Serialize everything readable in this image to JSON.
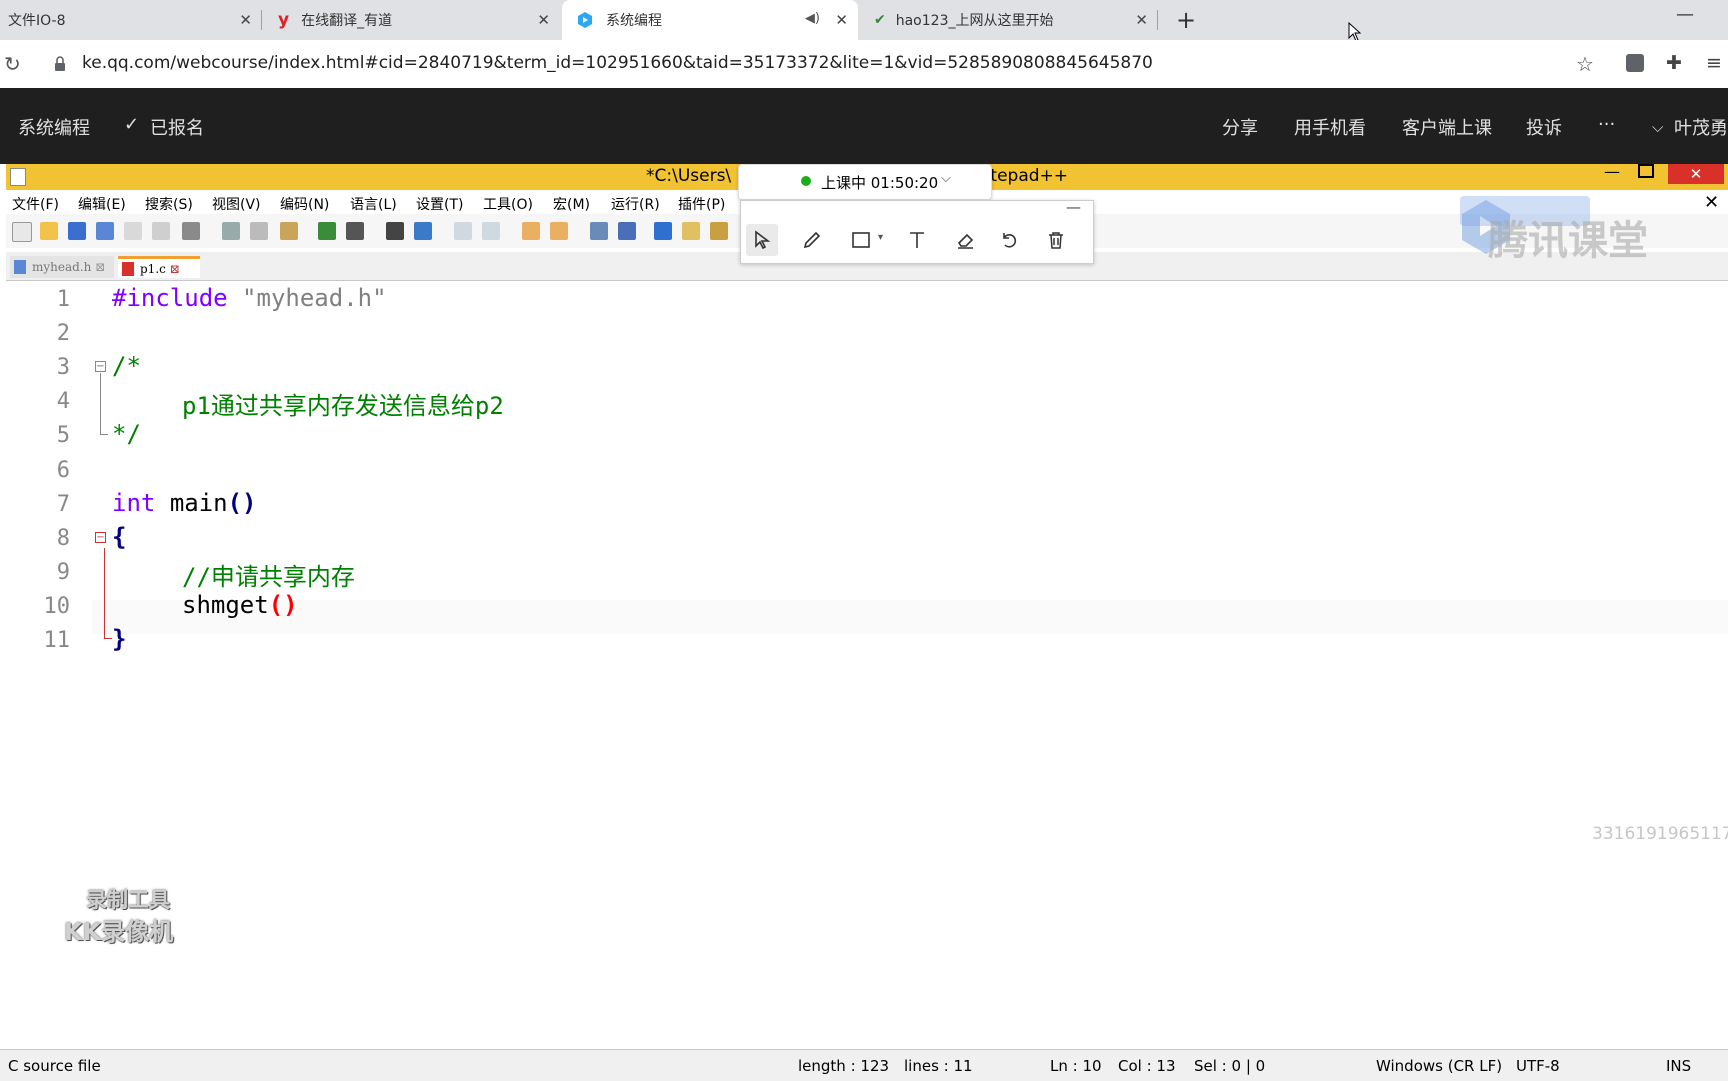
{
  "browser": {
    "tabs": [
      {
        "title": "文件IO-8"
      },
      {
        "title": "在线翻译_有道"
      },
      {
        "title": "系统编程"
      },
      {
        "title": "hao123_上网从这里开始"
      }
    ],
    "url": "ke.qq.com/webcourse/index.html#cid=2840719&term_id=102951660&taid=35173372&lite=1&vid=5285890808845645870"
  },
  "site": {
    "course_title": "系统编程",
    "enrolled": "已报名",
    "nav": [
      "分享",
      "用手机看",
      "客户端上课",
      "投诉",
      "···"
    ],
    "user": "叶茂勇"
  },
  "notepad": {
    "title_left": "*C:\\Users\\",
    "title_right": "otepad++",
    "menu": [
      "文件(F)",
      "编辑(E)",
      "搜索(S)",
      "视图(V)",
      "编码(N)",
      "语言(L)",
      "设置(T)",
      "工具(O)",
      "宏(M)",
      "运行(R)",
      "插件(P)"
    ],
    "doc_tabs": [
      "myhead.h",
      "p1.c"
    ],
    "lines": [
      "1",
      "2",
      "3",
      "4",
      "5",
      "6",
      "7",
      "8",
      "9",
      "10",
      "11"
    ],
    "code": {
      "l1_kw": "#include",
      "l1_str": "\"myhead.h\"",
      "l3": "/*",
      "l4": "p1通过共享内存发送信息给p2",
      "l5": "*/",
      "l7_kw": "int",
      "l7_fn": "main",
      "l7_paren": "()",
      "l8": "{",
      "l9": "//申请共享内存",
      "l10_fn": "shmget",
      "l10_paren": "()",
      "l11": "}"
    },
    "status": {
      "type": "C source file",
      "length": "length : 123",
      "lines": "lines : 11",
      "ln": "Ln : 10",
      "col": "Col : 13",
      "sel": "Sel : 0 | 0",
      "eol": "Windows (CR LF)",
      "enc": "UTF-8",
      "mode": "INS"
    }
  },
  "overlay": {
    "live_status": "上课中 01:50:20",
    "watermark_brand": "腾讯课堂",
    "watermark_id": "3316191965117",
    "recorder_line1": "录制工具",
    "recorder_line2": "KK录像机"
  },
  "colors": {
    "notepad_title": "#f1c232",
    "site_header": "#1f1f1f",
    "live_dot": "#1aad19"
  }
}
